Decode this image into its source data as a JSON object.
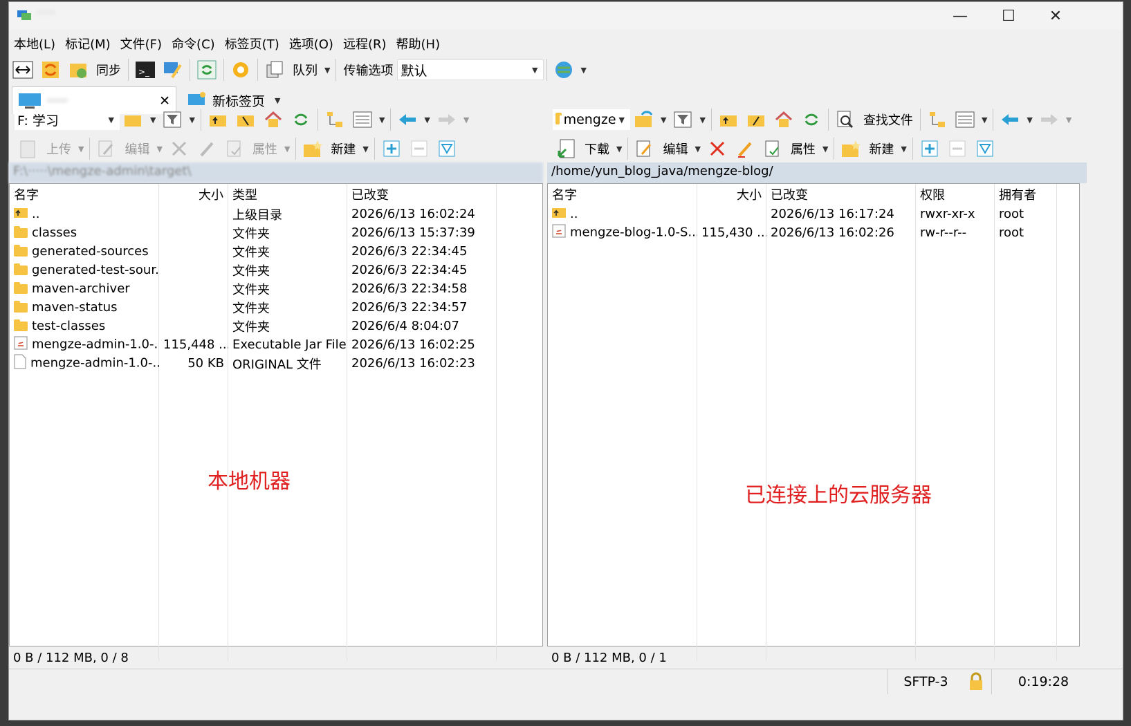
{
  "window": {
    "title_blurred": "·····",
    "controls": {
      "minimize": "—",
      "maximize": "☐",
      "close": "✕"
    }
  },
  "menu": [
    "本地(L)",
    "标记(M)",
    "文件(F)",
    "命令(C)",
    "标签页(T)",
    "选项(O)",
    "远程(R)",
    "帮助(H)"
  ],
  "toolbar1": {
    "sync_label": "同步",
    "queue_label": "队列",
    "transfer_label": "传输选项",
    "transfer_value": "默认"
  },
  "tabs": {
    "session_tab": "·····",
    "new_tab": "新标签页",
    "close": "✕"
  },
  "local": {
    "drive": "F: 学习",
    "upload": "上传",
    "edit": "编辑",
    "props": "属性",
    "new": "新建",
    "path": "F:\\·····\\mengze-admin\\target\\",
    "columns": [
      "名字",
      "大小",
      "类型",
      "已改变"
    ],
    "rows": [
      {
        "name": "..",
        "size": "",
        "type": "上级目录",
        "changed": "2026/6/13 16:02:24",
        "icon": "parent"
      },
      {
        "name": "classes",
        "size": "",
        "type": "文件夹",
        "changed": "2026/6/13 15:37:39",
        "icon": "folder"
      },
      {
        "name": "generated-sources",
        "size": "",
        "type": "文件夹",
        "changed": "2026/6/3 22:34:45",
        "icon": "folder"
      },
      {
        "name": "generated-test-sour...",
        "size": "",
        "type": "文件夹",
        "changed": "2026/6/3 22:34:45",
        "icon": "folder"
      },
      {
        "name": "maven-archiver",
        "size": "",
        "type": "文件夹",
        "changed": "2026/6/3 22:34:58",
        "icon": "folder"
      },
      {
        "name": "maven-status",
        "size": "",
        "type": "文件夹",
        "changed": "2026/6/3 22:34:57",
        "icon": "folder"
      },
      {
        "name": "test-classes",
        "size": "",
        "type": "文件夹",
        "changed": "2026/6/4 8:04:07",
        "icon": "folder"
      },
      {
        "name": "mengze-admin-1.0-...",
        "size": "115,448 ...",
        "type": "Executable Jar File",
        "changed": "2026/6/13 16:02:25",
        "icon": "jar"
      },
      {
        "name": "mengze-admin-1.0-...",
        "size": "50 KB",
        "type": "ORIGINAL 文件",
        "changed": "2026/6/13 16:02:23",
        "icon": "file"
      }
    ],
    "status": "0 B / 112 MB,   0 / 8",
    "annotation": "本地机器"
  },
  "remote": {
    "dir": "mengze",
    "find": "查找文件",
    "download": "下载",
    "edit": "编辑",
    "props": "属性",
    "new": "新建",
    "path": "/home/yun_blog_java/mengze-blog/",
    "columns": [
      "名字",
      "大小",
      "已改变",
      "权限",
      "拥有者"
    ],
    "rows": [
      {
        "name": "..",
        "size": "",
        "changed": "2026/6/13 16:17:24",
        "perm": "rwxr-xr-x",
        "owner": "root",
        "icon": "parent"
      },
      {
        "name": "mengze-blog-1.0-S...",
        "size": "115,430 ...",
        "changed": "2026/6/13 16:02:26",
        "perm": "rw-r--r--",
        "owner": "root",
        "icon": "jar"
      }
    ],
    "status": "0 B / 112 MB,   0 / 1",
    "annotation": "已连接上的云服务器"
  },
  "bottom": {
    "protocol": "SFTP-3",
    "time": "0:19:28"
  }
}
